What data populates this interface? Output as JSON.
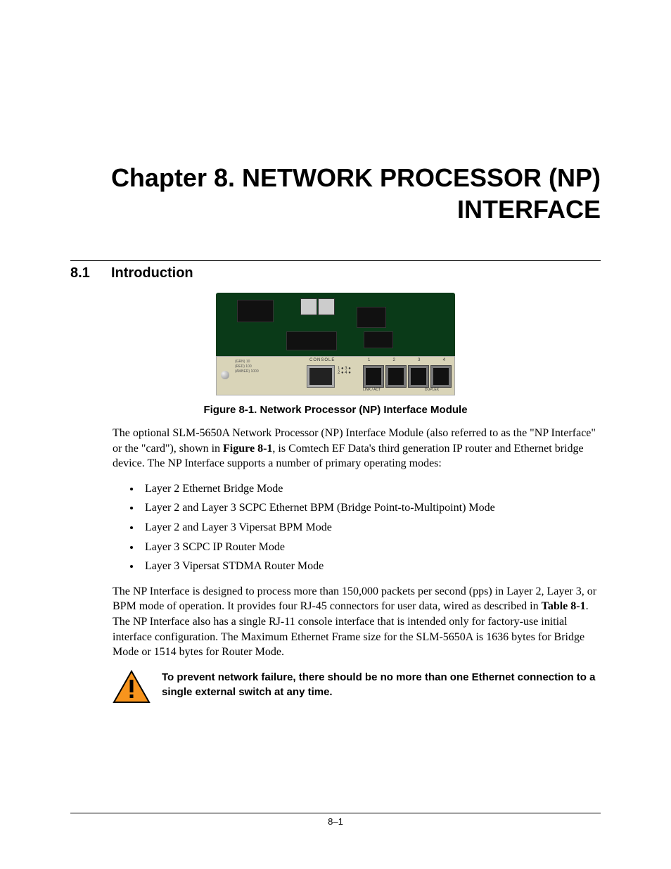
{
  "chapter_title": "Chapter 8. NETWORK PROCESSOR (NP) INTERFACE",
  "section": {
    "num": "8.1",
    "title": "Introduction"
  },
  "figure": {
    "caption": "Figure 8-1. Network Processor (NP) Interface Module",
    "faceplate": {
      "console_label": "CONSOLE",
      "port_nums": [
        "1",
        "2",
        "3",
        "4"
      ],
      "leds1": "1 ● 3 ●",
      "leds2": "2 ● 4 ●",
      "linkact": "LINK / ACT",
      "duplex": "DUPLEX",
      "side_rows": [
        "(GRN)   10",
        "(RED)   100",
        "(AMBER) 1000"
      ]
    }
  },
  "para1_a": "The optional SLM-5650A Network Processor (NP) Interface Module (also referred to as the \"NP Interface\" or the \"card\"), shown in ",
  "para1_fig": "Figure 8-1",
  "para1_b": ", is Comtech EF Data's third generation IP router and Ethernet bridge device. The NP Interface supports a number of primary operating modes:",
  "modes": [
    "Layer 2 Ethernet Bridge Mode",
    "Layer 2 and Layer 3 SCPC Ethernet BPM (Bridge Point-to-Multipoint) Mode",
    "Layer 2 and Layer 3 Vipersat BPM Mode",
    "Layer 3 SCPC IP Router Mode",
    "Layer 3 Vipersat STDMA Router Mode"
  ],
  "para2_a": "The NP Interface is designed to process more than 150,000 packets per second (pps) in Layer 2, Layer 3, or BPM mode of operation. It provides four RJ-45 connectors for user data, wired as described in ",
  "para2_tbl": "Table 8-1",
  "para2_b": ". The NP Interface also has a single RJ-11 console interface that is intended only for factory-use initial interface configuration. The Maximum Ethernet Frame size for the SLM-5650A is 1636 bytes for Bridge Mode or 1514 bytes for Router Mode.",
  "warning": "To prevent network failure, there should be no more than one Ethernet connection to a single external switch at any time.",
  "page_num": "8–1"
}
